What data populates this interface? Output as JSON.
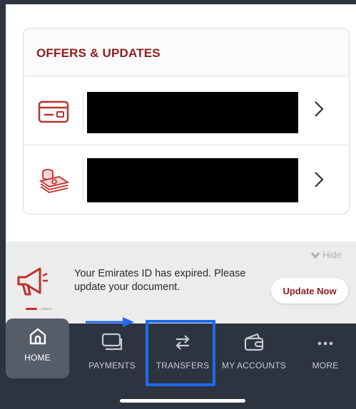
{
  "offers": {
    "title": "OFFERS & UPDATES",
    "items": [
      {
        "icon": "credit-card-icon",
        "text": ""
      },
      {
        "icon": "cash-stack-icon",
        "text": ""
      }
    ]
  },
  "banner": {
    "hide_label": "Hide",
    "message": "Your Emirates ID has expired. Please update your document.",
    "button_label": "Update Now"
  },
  "tabbar": {
    "items": [
      {
        "label": "HOME",
        "icon": "home-icon",
        "active": true
      },
      {
        "label": "PAYMENTS",
        "icon": "payments-icon"
      },
      {
        "label": "TRANSFERS",
        "icon": "transfer-arrows-icon"
      },
      {
        "label": "MY ACCOUNTS",
        "icon": "wallet-icon"
      },
      {
        "label": "MORE",
        "icon": "more-dots-icon"
      }
    ]
  },
  "colors": {
    "brand": "#8b1e1e",
    "tabbar": "#2e3340",
    "highlight": "#1d6bf0"
  }
}
